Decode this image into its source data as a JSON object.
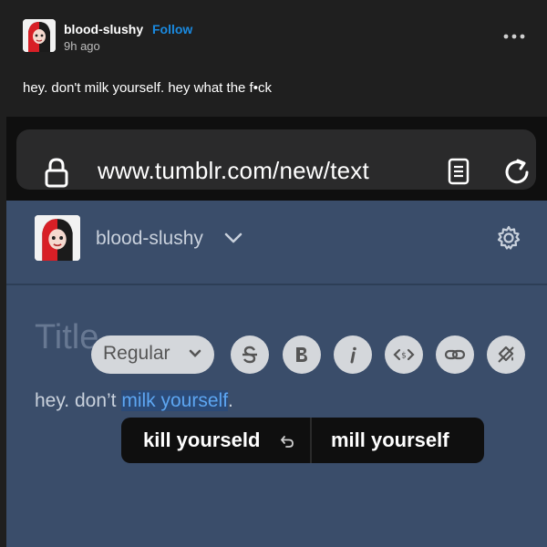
{
  "post": {
    "username": "blood-slushy",
    "follow_label": "Follow",
    "time": "9h ago",
    "text": "hey. don't milk yourself. hey what the f•ck"
  },
  "browser": {
    "url": "www.tumblr.com/new/text"
  },
  "editor": {
    "blog_name": "blood-slushy",
    "title_placeholder": "Title",
    "toolbar": {
      "style_label": "Regular"
    },
    "body_before": "hey. don’t ",
    "body_selected": "milk yourself",
    "body_after": "."
  },
  "autocorrect": {
    "suggestion_1": "kill yourseld",
    "suggestion_2": "mill yourself"
  },
  "colors": {
    "accent_follow": "#1a8ae0",
    "editor_background": "#3a4d6a",
    "selection_text": "#5da6f2"
  },
  "icons": [
    "more-icon",
    "lock-icon",
    "reader-icon",
    "reload-icon",
    "chevron-down-icon",
    "gear-icon",
    "strikethrough-icon",
    "bold-icon",
    "italic-icon",
    "code-icon",
    "link-icon",
    "format-paint-icon",
    "undo-icon"
  ]
}
